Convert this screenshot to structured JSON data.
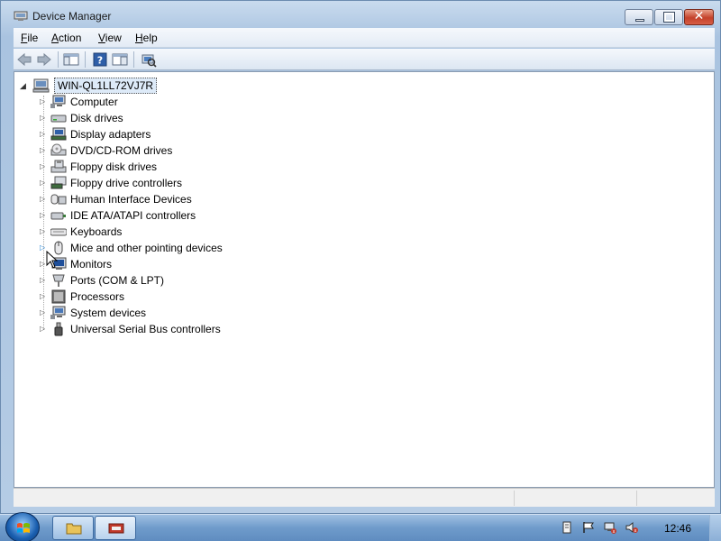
{
  "window": {
    "title": "Device Manager"
  },
  "menu": [
    {
      "label": "File"
    },
    {
      "label": "Action"
    },
    {
      "label": "View"
    },
    {
      "label": "Help"
    }
  ],
  "toolbar": {
    "buttons": [
      "back-icon",
      "forward-icon",
      "show-hide-console-tree-icon",
      "help-icon",
      "properties-icon",
      "scan-hardware-icon"
    ]
  },
  "tree": {
    "root": "WIN-QL1LL72VJ7R",
    "categories": [
      {
        "label": "Computer",
        "icon": "computer-icon"
      },
      {
        "label": "Disk drives",
        "icon": "disk-drive-icon"
      },
      {
        "label": "Display adapters",
        "icon": "display-adapter-icon"
      },
      {
        "label": "DVD/CD-ROM drives",
        "icon": "dvd-drive-icon"
      },
      {
        "label": "Floppy disk drives",
        "icon": "floppy-drive-icon"
      },
      {
        "label": "Floppy drive controllers",
        "icon": "floppy-controller-icon"
      },
      {
        "label": "Human Interface Devices",
        "icon": "hid-icon"
      },
      {
        "label": "IDE ATA/ATAPI controllers",
        "icon": "ide-controller-icon"
      },
      {
        "label": "Keyboards",
        "icon": "keyboard-icon"
      },
      {
        "label": "Mice and other pointing devices",
        "icon": "mouse-icon"
      },
      {
        "label": "Monitors",
        "icon": "monitor-icon"
      },
      {
        "label": "Ports (COM & LPT)",
        "icon": "port-icon"
      },
      {
        "label": "Processors",
        "icon": "processor-icon"
      },
      {
        "label": "System devices",
        "icon": "system-device-icon"
      },
      {
        "label": "Universal Serial Bus controllers",
        "icon": "usb-icon"
      }
    ]
  },
  "taskbar": {
    "clock": "12:46",
    "tray_icons": [
      "action-center-icon",
      "flag-icon",
      "network-icon",
      "volume-muted-icon"
    ]
  },
  "colors": {
    "selection_bg": "#ddeaf8",
    "taskbar": "#6f9bcb",
    "close_button": "#c4422b"
  }
}
